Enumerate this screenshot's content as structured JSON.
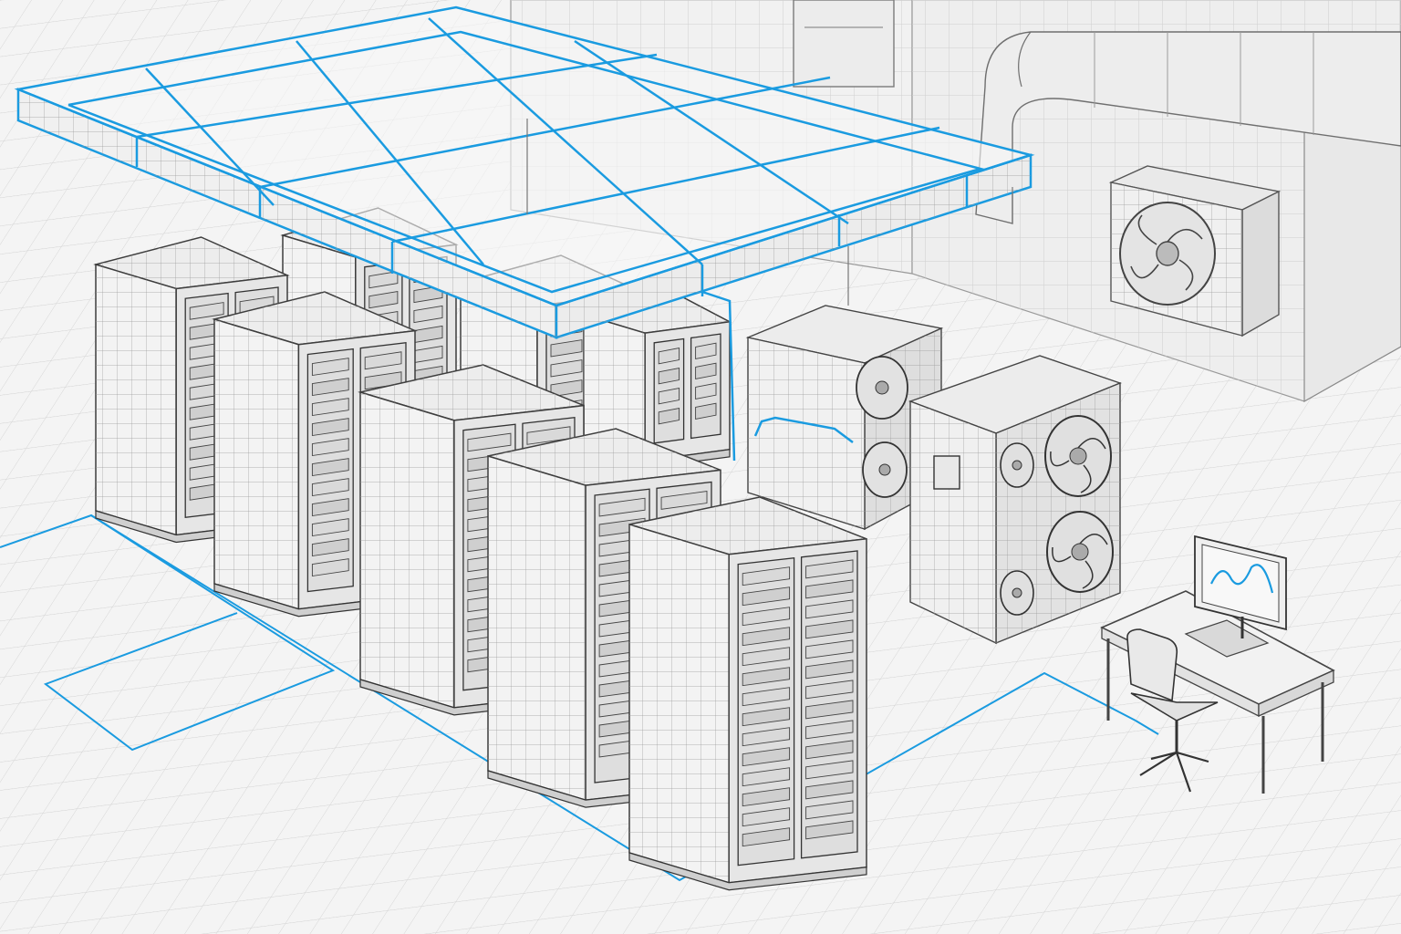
{
  "colors": {
    "paper": "#f4f4f4",
    "grid": "#d2d2d2",
    "ink": "#4a4a4a",
    "ink_light": "#8a8a8a",
    "accent": "#1a9be0"
  },
  "scene": {
    "racks": [
      {
        "name": "rack-back-row-1"
      },
      {
        "name": "rack-back-row-2"
      },
      {
        "name": "rack-back-row-3"
      },
      {
        "name": "rack-front-1"
      },
      {
        "name": "rack-front-2"
      },
      {
        "name": "rack-front-3"
      },
      {
        "name": "rack-front-4"
      },
      {
        "name": "rack-front-5"
      }
    ],
    "cooling_units": [
      {
        "name": "cooling-unit-rear",
        "fans": 2
      },
      {
        "name": "cooling-unit-front",
        "fans": 4
      }
    ],
    "wall_unit": {
      "name": "wall-ac-unit",
      "fans": 1
    },
    "workstation": {
      "name": "operator-workstation",
      "items": [
        "desk",
        "monitor",
        "chair"
      ]
    }
  }
}
